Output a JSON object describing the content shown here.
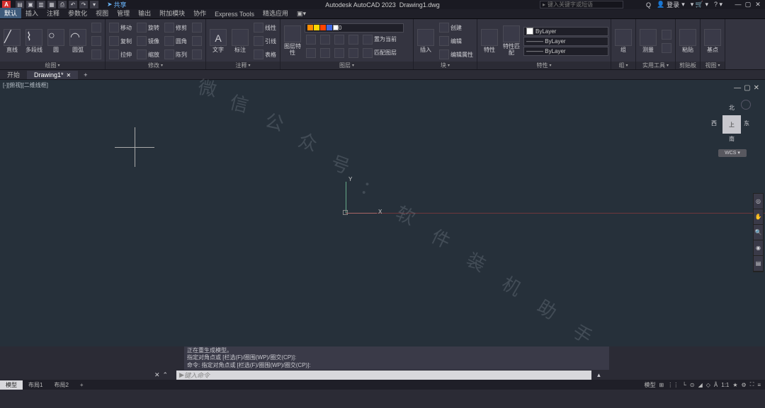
{
  "title": {
    "app": "Autodesk AutoCAD 2023",
    "doc": "Drawing1.dwg",
    "share": "共享",
    "search_placeholder": "键入关键字或短语",
    "login": "登录",
    "logo": "A"
  },
  "menu": {
    "tabs": [
      "默认",
      "插入",
      "注释",
      "参数化",
      "视图",
      "管理",
      "输出",
      "附加模块",
      "协作",
      "Express Tools",
      "精选应用"
    ],
    "active": 0
  },
  "ribbon": {
    "draw": {
      "title": "绘图",
      "line": "直线",
      "polyline": "多段线",
      "circle": "圆",
      "arc": "圆弧"
    },
    "modify": {
      "title": "修改",
      "move": "移动",
      "rotate": "旋转",
      "trim": "修剪",
      "copy": "复制",
      "mirror": "镜像",
      "fillet": "圆角",
      "stretch": "拉伸",
      "scale": "缩放",
      "array": "陈列"
    },
    "annot": {
      "title": "注释",
      "text": "文字",
      "dim": "标注",
      "linear": "线性",
      "leader": "引线",
      "table": "表格"
    },
    "layers": {
      "title": "图层",
      "props": "图层特性",
      "current": "0",
      "btn1": "置为当前",
      "btn2": "匹配图层"
    },
    "block": {
      "title": "块",
      "insert": "插入",
      "create": "创建",
      "edit": "编辑",
      "attr": "编辑属性"
    },
    "props": {
      "title": "特性",
      "btn": "特性",
      "match": "特性匹配",
      "layer": "ByLayer",
      "lt": "ByLayer",
      "lw": "ByLayer"
    },
    "group": {
      "title": "组",
      "btn": "组"
    },
    "util": {
      "title": "实用工具",
      "btn": "测量"
    },
    "clip": {
      "title": "剪贴板",
      "btn": "粘贴"
    },
    "view": {
      "title": "视图",
      "btn": "基点"
    }
  },
  "file_tabs": {
    "start": "开始",
    "doc": "Drawing1*"
  },
  "viewport": {
    "label": "[-][俯视][二维线框]",
    "y": "Y",
    "x": "X",
    "wcs": "WCS",
    "cube_face": "上",
    "n": "北",
    "s": "南",
    "w": "西",
    "e": "东"
  },
  "watermark": {
    "t1": "微",
    "t2": "信",
    "t3": "公",
    "t4": "众",
    "t5": "号",
    "t6": "：",
    "t7": "软",
    "t8": "件",
    "t9": "装",
    "t10": "机",
    "t11": "助",
    "t12": "手"
  },
  "cmd": {
    "h1": "正在重生成模型。",
    "h2": "指定对角点或 [栏选(F)/圈围(WP)/圈交(CP)]:",
    "h3": "命令: 指定对角点或 [栏选(F)/圈围(WP)/圈交(CP)]:",
    "placeholder": "键入命令"
  },
  "status": {
    "model": "模型",
    "layout1": "布局1",
    "layout2": "布局2",
    "model2": "模型",
    "scale": "1:1"
  }
}
